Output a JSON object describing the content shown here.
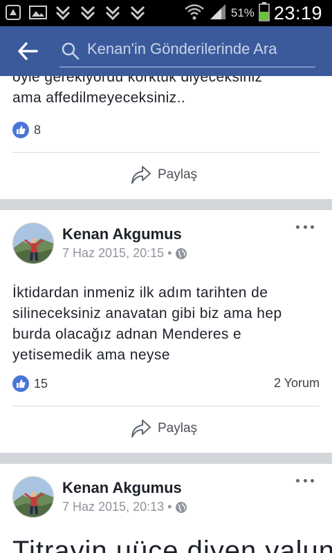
{
  "status_bar": {
    "battery_pct": "51%",
    "time": "23:19",
    "icons": [
      "notification-icon",
      "image-icon",
      "download-icon",
      "download-icon",
      "download-icon",
      "download-icon",
      "wifi-icon",
      "signal-icon",
      "battery-icon"
    ]
  },
  "header": {
    "search_placeholder": "Kenan'in Gönderilerinde Ara",
    "back_icon": "arrow-left-icon",
    "search_icon": "search-icon"
  },
  "posts": [
    {
      "text_lines": [
        "öyle gerekiyordu korktuk diyeceksiniz",
        "ama affedilmeyeceksiniz.."
      ],
      "likes": "8",
      "share_label": "Paylaş"
    },
    {
      "author": "Kenan Akgumus",
      "date": "7 Haz 2015, 20:15",
      "text_lines": [
        "İktidardan inmeniz ilk adım tarihten de",
        "silineceksiniz anavatan gibi biz ama hep",
        "burda olacağız adnan Menderes e",
        "yetisemedik ama neyse"
      ],
      "likes": "15",
      "comments": "2 Yorum",
      "share_label": "Paylaş"
    },
    {
      "author": "Kenan Akgumus",
      "date": "7 Haz 2015, 20:13",
      "text_lines": [
        "Titrayin uüce diyen yalunuz"
      ]
    }
  ],
  "colors": {
    "header_bg": "#3a5a9b",
    "like_blue": "#4a76d8",
    "separator_gray": "#d3d6db"
  }
}
